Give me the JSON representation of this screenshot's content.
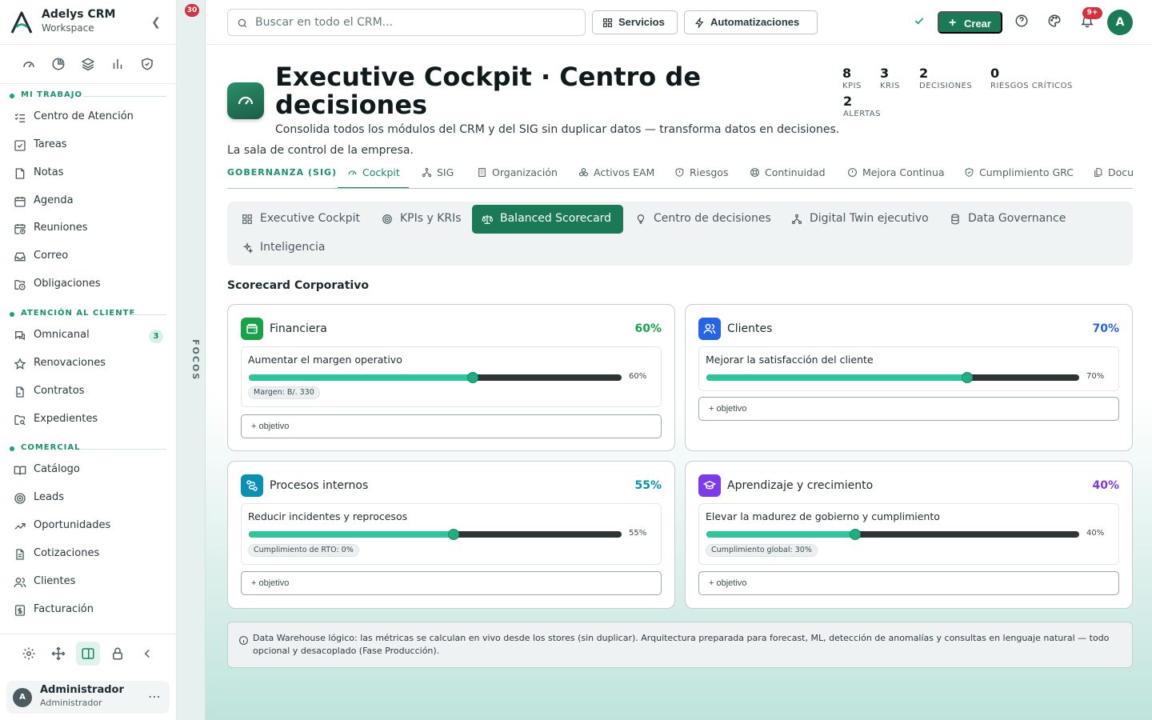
{
  "brand": {
    "title": "Adelys CRM",
    "subtitle": "Workspace"
  },
  "quick_icons": [
    "gauge-icon",
    "pie-chart-icon",
    "layers-icon",
    "bar-chart-icon",
    "shield-check-icon"
  ],
  "sidebar": {
    "sections": [
      {
        "title": "MI TRABAJO",
        "items": [
          {
            "label": "Centro de Atención",
            "icon": "list-check-icon"
          },
          {
            "label": "Tareas",
            "icon": "checkbox-icon"
          },
          {
            "label": "Notas",
            "icon": "note-icon"
          },
          {
            "label": "Agenda",
            "icon": "calendar-icon"
          },
          {
            "label": "Reuniones",
            "icon": "calendar-clock-icon"
          },
          {
            "label": "Correo",
            "icon": "inbox-icon"
          },
          {
            "label": "Obligaciones",
            "icon": "folder-clock-icon"
          }
        ]
      },
      {
        "title": "ATENCIÓN AL CLIENTE",
        "items": [
          {
            "label": "Omnicanal",
            "icon": "chat-icon",
            "badge": "3"
          },
          {
            "label": "Renovaciones",
            "icon": "star-icon"
          },
          {
            "label": "Contratos",
            "icon": "file-signature-icon"
          },
          {
            "label": "Expedientes",
            "icon": "folder-search-icon"
          }
        ]
      },
      {
        "title": "COMERCIAL",
        "items": [
          {
            "label": "Catálogo",
            "icon": "book-open-icon"
          },
          {
            "label": "Leads",
            "icon": "target-icon"
          },
          {
            "label": "Oportunidades",
            "icon": "trending-up-icon"
          },
          {
            "label": "Cotizaciones",
            "icon": "file-text-icon"
          },
          {
            "label": "Clientes",
            "icon": "users-icon"
          },
          {
            "label": "Facturación",
            "icon": "receipt-icon"
          }
        ]
      }
    ]
  },
  "user": {
    "initial": "A",
    "name": "Administrador",
    "role": "Administrador"
  },
  "focos": {
    "label": "FOCOS",
    "badge": "30"
  },
  "topbar": {
    "search_placeholder": "Buscar en todo el CRM...",
    "servicios": "Servicios",
    "automatizaciones": "Automatizaciones",
    "crear": "Crear",
    "notif_badge": "9+",
    "avatar": "A"
  },
  "header": {
    "title": "Executive Cockpit · Centro de decisiones",
    "description": "Consolida todos los módulos del CRM y del SIG sin duplicar datos — transforma datos en decisiones.",
    "subtitle": "La sala de control de la empresa.",
    "stats": [
      {
        "value": "8",
        "label": "KPIS"
      },
      {
        "value": "3",
        "label": "KRIS"
      },
      {
        "value": "2",
        "label": "DECISIONES"
      },
      {
        "value": "0",
        "label": "RIESGOS CRÍTICOS"
      },
      {
        "value": "2",
        "label": "ALERTAS"
      }
    ]
  },
  "module_tabs": {
    "group": "GOBERNANZA (SIG)",
    "tabs": [
      {
        "label": "Cockpit",
        "icon": "gauge-icon",
        "active": true
      },
      {
        "label": "SIG",
        "icon": "network-icon"
      },
      {
        "label": "Organización",
        "icon": "building-icon"
      },
      {
        "label": "Activos EAM",
        "icon": "boxes-icon"
      },
      {
        "label": "Riesgos",
        "icon": "shield-alert-icon"
      },
      {
        "label": "Continuidad",
        "icon": "lifebuoy-icon"
      },
      {
        "label": "Mejora Continua",
        "icon": "alert-circle-icon"
      },
      {
        "label": "Cumplimiento GRC",
        "icon": "shield-check-icon"
      },
      {
        "label": "Docu",
        "icon": "files-icon"
      }
    ]
  },
  "sub_tabs": [
    {
      "label": "Executive Cockpit",
      "icon": "grid-icon"
    },
    {
      "label": "KPIs y KRIs",
      "icon": "target-icon"
    },
    {
      "label": "Balanced Scorecard",
      "icon": "scale-icon",
      "active": true
    },
    {
      "label": "Centro de decisiones",
      "icon": "lightbulb-icon"
    },
    {
      "label": "Digital Twin ejecutivo",
      "icon": "network-icon"
    },
    {
      "label": "Data Governance",
      "icon": "database-icon"
    },
    {
      "label": "Inteligencia",
      "icon": "sparkles-icon"
    }
  ],
  "scorecard": {
    "title": "Scorecard Corporativo",
    "add_label": "+ objetivo",
    "perspectives": [
      {
        "name": "Financiera",
        "percent": "60%",
        "color": "#16a34a",
        "icon": "wallet-icon",
        "objectives": [
          {
            "name": "Aumentar el margen operativo",
            "progress": 60,
            "percent": "60%",
            "metric": "Margen: B/. 330"
          }
        ]
      },
      {
        "name": "Clientes",
        "percent": "70%",
        "color": "#2563eb",
        "icon": "users-icon",
        "objectives": [
          {
            "name": "Mejorar la satisfacción del cliente",
            "progress": 70,
            "percent": "70%"
          }
        ]
      },
      {
        "name": "Procesos internos",
        "percent": "55%",
        "color": "#0891b2",
        "icon": "route-icon",
        "objectives": [
          {
            "name": "Reducir incidentes y reprocesos",
            "progress": 55,
            "percent": "55%",
            "metric": "Cumplimiento de RTO: 0%"
          }
        ]
      },
      {
        "name": "Aprendizaje y crecimiento",
        "percent": "40%",
        "color": "#7c3aed",
        "icon": "graduation-cap-icon",
        "objectives": [
          {
            "name": "Elevar la madurez de gobierno y cumplimiento",
            "progress": 40,
            "percent": "40%",
            "metric": "Cumplimiento global: 30%"
          }
        ]
      }
    ]
  },
  "info_note": "Data Warehouse lógico: las métricas se calculan en vivo desde los stores (sin duplicar). Arquitectura preparada para forecast, ML, detección de anomalías y consultas en lenguaje natural — todo opcional y desacoplado (Fase Producción)."
}
